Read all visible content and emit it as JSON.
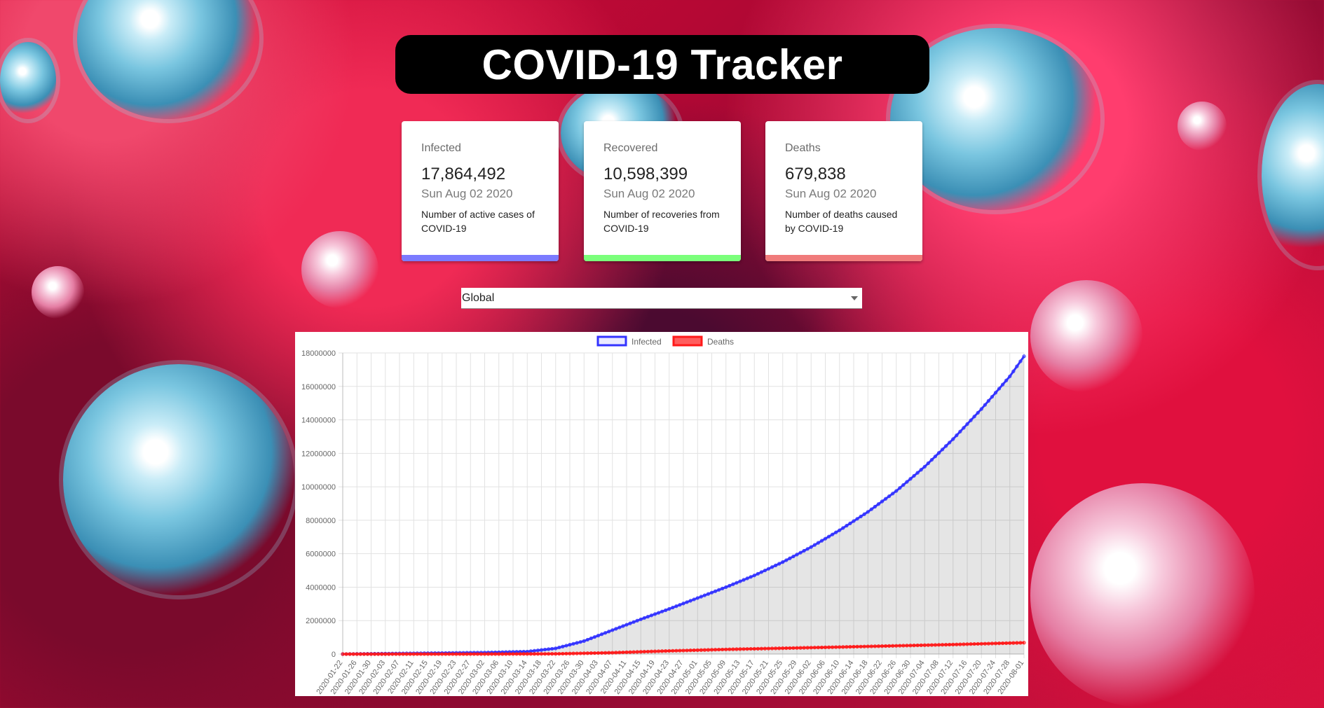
{
  "title": "COVID-19 Tracker",
  "cards": [
    {
      "title": "Infected",
      "value": "17,864,492",
      "date": "Sun Aug 02 2020",
      "description": "Number of active cases of COVID-19",
      "color": "#7b7bff"
    },
    {
      "title": "Recovered",
      "value": "10,598,399",
      "date": "Sun Aug 02 2020",
      "description": "Number of recoveries from COVID-19",
      "color": "#7bff7b"
    },
    {
      "title": "Deaths",
      "value": "679,838",
      "date": "Sun Aug 02 2020",
      "description": "Number of deaths caused by COVID-19",
      "color": "#f07b7b"
    }
  ],
  "country_select": {
    "selected": "Global"
  },
  "chart_data": {
    "type": "line",
    "start_date": "2020-01-22",
    "end_date": "2020-08-01",
    "x_tick_labels": [
      "2020-01-22",
      "2020-01-26",
      "2020-01-30",
      "2020-02-03",
      "2020-02-07",
      "2020-02-11",
      "2020-02-15",
      "2020-02-19",
      "2020-02-23",
      "2020-02-27",
      "2020-03-02",
      "2020-03-06",
      "2020-03-10",
      "2020-03-14",
      "2020-03-18",
      "2020-03-22",
      "2020-03-26",
      "2020-03-30",
      "2020-04-03",
      "2020-04-07",
      "2020-04-11",
      "2020-04-15",
      "2020-04-19",
      "2020-04-23",
      "2020-04-27",
      "2020-05-01",
      "2020-05-05",
      "2020-05-09",
      "2020-05-13",
      "2020-05-17",
      "2020-05-21",
      "2020-05-25",
      "2020-05-29",
      "2020-06-02",
      "2020-06-06",
      "2020-06-10",
      "2020-06-14",
      "2020-06-18",
      "2020-06-22",
      "2020-06-26",
      "2020-06-30",
      "2020-07-04",
      "2020-07-08",
      "2020-07-12",
      "2020-07-16",
      "2020-07-20",
      "2020-07-24",
      "2020-07-28",
      "2020-08-01"
    ],
    "y_ticks": [
      0,
      2000000,
      4000000,
      6000000,
      8000000,
      10000000,
      12000000,
      14000000,
      16000000,
      18000000
    ],
    "ylim": [
      0,
      18000000
    ],
    "grid": true,
    "legend_position": "top",
    "series": [
      {
        "name": "Infected",
        "color": "#3333ff",
        "fill": "rgba(0,0,0,0.1)",
        "points": [
          [
            "2020-01-22",
            555
          ],
          [
            "2020-02-11",
            45000
          ],
          [
            "2020-03-02",
            90000
          ],
          [
            "2020-03-14",
            150000
          ],
          [
            "2020-03-22",
            340000
          ],
          [
            "2020-03-30",
            780000
          ],
          [
            "2020-04-07",
            1430000
          ],
          [
            "2020-04-15",
            2080000
          ],
          [
            "2020-04-23",
            2700000
          ],
          [
            "2020-05-01",
            3350000
          ],
          [
            "2020-05-09",
            4000000
          ],
          [
            "2020-05-17",
            4700000
          ],
          [
            "2020-05-25",
            5500000
          ],
          [
            "2020-06-02",
            6400000
          ],
          [
            "2020-06-10",
            7400000
          ],
          [
            "2020-06-18",
            8500000
          ],
          [
            "2020-06-26",
            9750000
          ],
          [
            "2020-07-04",
            11200000
          ],
          [
            "2020-07-12",
            12850000
          ],
          [
            "2020-07-20",
            14650000
          ],
          [
            "2020-07-28",
            16600000
          ],
          [
            "2020-08-01",
            17800000
          ]
        ]
      },
      {
        "name": "Deaths",
        "color": "#ff1a1a",
        "fill": "none",
        "points": [
          [
            "2020-01-22",
            17
          ],
          [
            "2020-03-02",
            3100
          ],
          [
            "2020-03-22",
            15000
          ],
          [
            "2020-04-07",
            82000
          ],
          [
            "2020-04-23",
            190000
          ],
          [
            "2020-05-09",
            280000
          ],
          [
            "2020-05-25",
            350000
          ],
          [
            "2020-06-10",
            420000
          ],
          [
            "2020-06-26",
            495000
          ],
          [
            "2020-07-12",
            570000
          ],
          [
            "2020-07-28",
            660000
          ],
          [
            "2020-08-01",
            680000
          ]
        ]
      }
    ]
  }
}
